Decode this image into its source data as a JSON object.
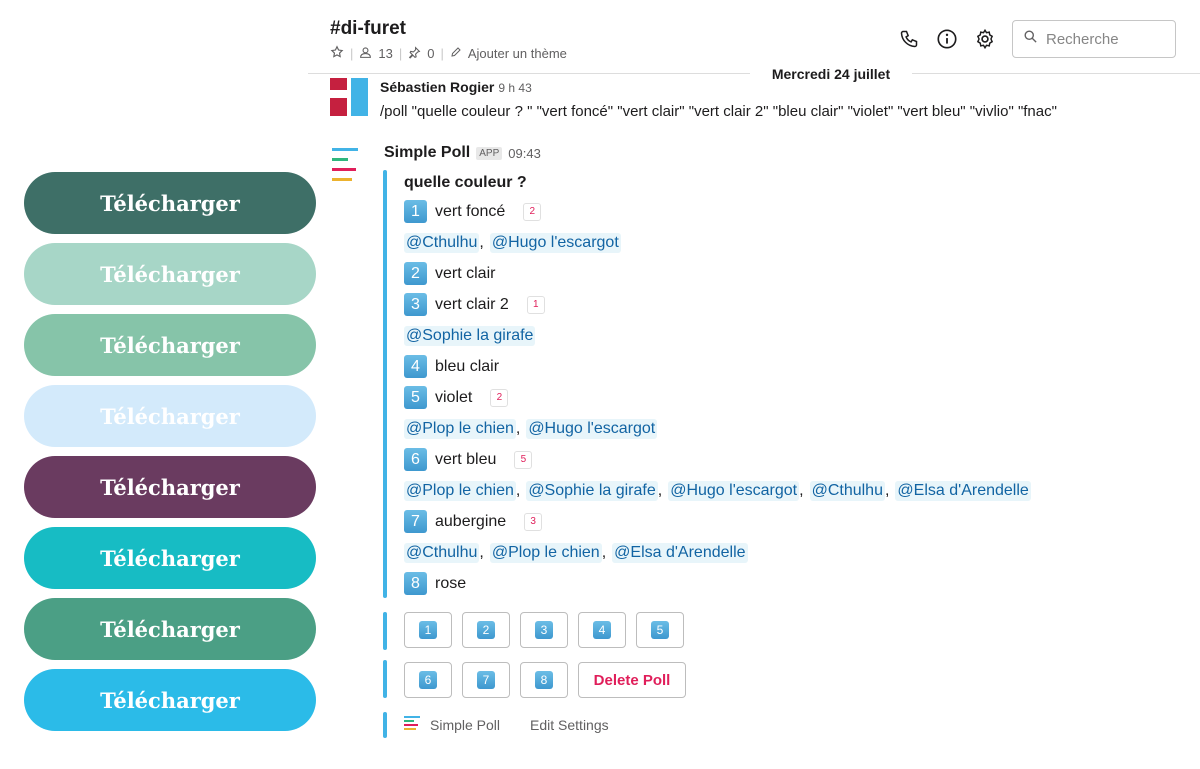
{
  "download_buttons": [
    {
      "label": "Télécharger",
      "color": "#3e6f67"
    },
    {
      "label": "Télécharger",
      "color": "#a7d6c7"
    },
    {
      "label": "Télécharger",
      "color": "#86c4a9"
    },
    {
      "label": "Télécharger",
      "color": "#d3eafb"
    },
    {
      "label": "Télécharger",
      "color": "#6a3b60"
    },
    {
      "label": "Télécharger",
      "color": "#17bcc4"
    },
    {
      "label": "Télécharger",
      "color": "#4b9f85"
    },
    {
      "label": "Télécharger",
      "color": "#2bbbe8"
    }
  ],
  "header": {
    "channel": "#di-furet",
    "members": "13",
    "pins": "0",
    "add_topic": "Ajouter un thème",
    "search_placeholder": "Recherche",
    "icons": [
      "phone-icon",
      "info-icon",
      "gear-icon",
      "search-icon",
      "star-icon",
      "member-icon",
      "pin-icon",
      "pencil-icon"
    ]
  },
  "date_divider": "Mercredi 24 juillet",
  "message1": {
    "author": "Sébastien Rogier",
    "time": "9 h 43",
    "text": "/poll \"quelle couleur ? \" \"vert foncé\" \"vert clair\" \"vert clair 2\" \"bleu clair\" \"violet\" \"vert bleu\" \"vivlio\" \"fnac\""
  },
  "poll": {
    "app_name": "Simple Poll",
    "app_badge": "APP",
    "time": "09:43",
    "question": "quelle couleur ?",
    "options": [
      {
        "num": "1",
        "label": "vert foncé",
        "votes": "2",
        "voters": [
          "@Cthulhu",
          "@Hugo l'escargot"
        ]
      },
      {
        "num": "2",
        "label": "vert clair",
        "votes": "",
        "voters": []
      },
      {
        "num": "3",
        "label": "vert clair 2",
        "votes": "1",
        "voters": [
          "@Sophie la girafe"
        ]
      },
      {
        "num": "4",
        "label": "bleu clair",
        "votes": "",
        "voters": []
      },
      {
        "num": "5",
        "label": "violet",
        "votes": "2",
        "voters": [
          "@Plop le chien",
          "@Hugo l'escargot"
        ]
      },
      {
        "num": "6",
        "label": "vert bleu",
        "votes": "5",
        "voters": [
          "@Plop le chien",
          "@Sophie la girafe",
          "@Hugo l'escargot",
          "@Cthulhu",
          "@Elsa d'Arendelle"
        ]
      },
      {
        "num": "7",
        "label": "aubergine",
        "votes": "3",
        "voters": [
          "@Cthulhu",
          "@Plop le chien",
          "@Elsa d'Arendelle"
        ]
      },
      {
        "num": "8",
        "label": "rose",
        "votes": "",
        "voters": []
      }
    ],
    "vote_buttons_row1": [
      "1",
      "2",
      "3",
      "4",
      "5"
    ],
    "vote_buttons_row2": [
      "6",
      "7",
      "8"
    ],
    "delete_label": "Delete Poll",
    "footer_app": "Simple Poll",
    "footer_settings": "Edit Settings"
  },
  "colors": {
    "accent_bar": "#41b3e6",
    "mention_bg": "#e8f5fa",
    "mention_text": "#1264a3",
    "danger": "#e01e5a"
  }
}
